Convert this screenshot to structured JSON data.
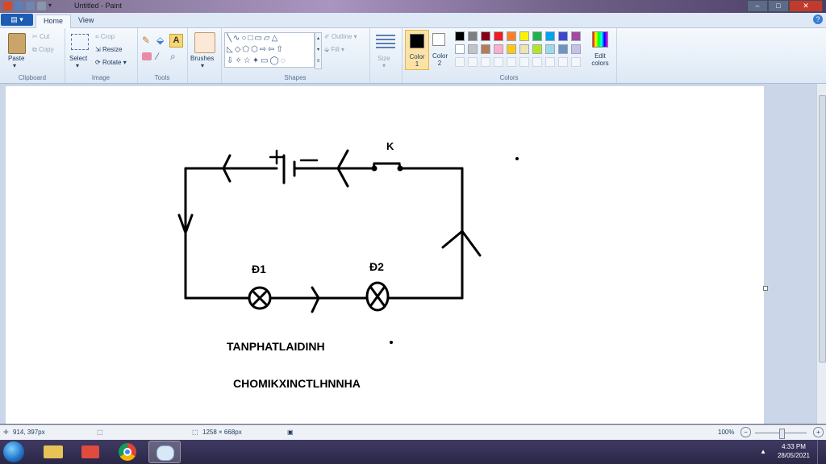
{
  "window": {
    "title": "Untitled - Paint"
  },
  "ribbon_tabs": {
    "home": "Home",
    "view": "View"
  },
  "clipboard": {
    "paste": "Paste",
    "cut": "Cut",
    "copy": "Copy",
    "group": "Clipboard"
  },
  "image": {
    "select": "Select",
    "crop": "Crop",
    "resize": "Resize",
    "rotate": "Rotate",
    "group": "Image"
  },
  "tools": {
    "group": "Tools"
  },
  "brushes": {
    "label": "Brushes"
  },
  "shapes": {
    "outline": "Outline",
    "fill": "Fill",
    "group": "Shapes"
  },
  "size": {
    "label": "Size"
  },
  "colors": {
    "color1_label": "Color 1",
    "color2_label": "Color 2",
    "edit": "Edit colors",
    "group": "Colors",
    "color1": "#000000",
    "color2": "#ffffff",
    "palette_row1": [
      "#000000",
      "#7f7f7f",
      "#880015",
      "#ed1c24",
      "#ff7f27",
      "#fff200",
      "#22b14c",
      "#00a2e8",
      "#3f48cc",
      "#a349a4"
    ],
    "palette_row2": [
      "#ffffff",
      "#c3c3c3",
      "#b97a57",
      "#ffaec9",
      "#ffc90e",
      "#efe4b0",
      "#b5e61d",
      "#99d9ea",
      "#7092be",
      "#c8bfe7"
    ]
  },
  "drawing": {
    "switch_label": "K",
    "lamp1_label": "Đ1",
    "lamp2_label": "Đ2",
    "text1": "TANPHATLAIDINH",
    "text2": "CHOMIKXINCTLHNNHA"
  },
  "status": {
    "cursor": "914, 397px",
    "canvas_size": "1258 × 668px",
    "zoom": "100%"
  },
  "taskbar": {
    "time": "4:33 PM",
    "date": "28/05/2021"
  }
}
